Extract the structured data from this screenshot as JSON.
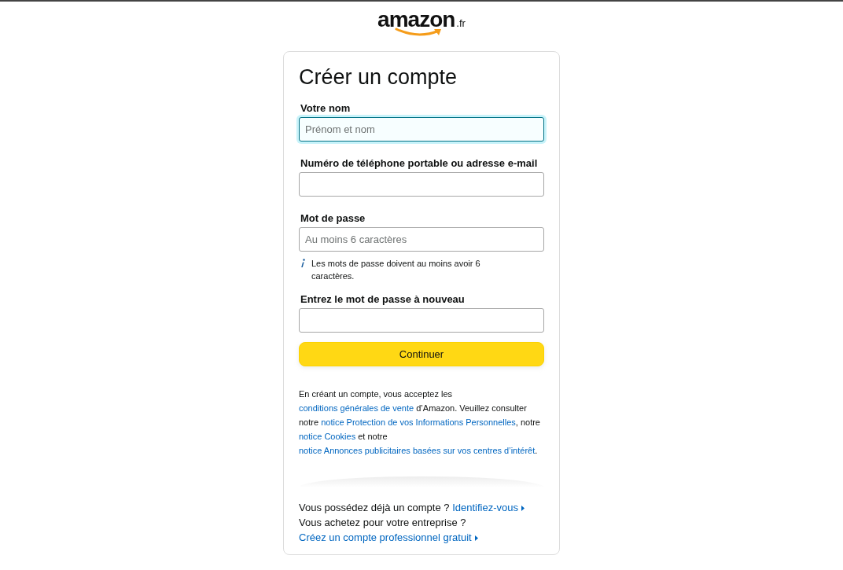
{
  "logo": {
    "wordmark": "amazon",
    "suffix": ".fr"
  },
  "card": {
    "title": "Créer un compte",
    "fields": [
      {
        "label": "Votre nom",
        "placeholder": "Prénom et nom",
        "focused": true
      },
      {
        "label": "Numéro de téléphone portable ou adresse e-mail",
        "focused": false
      },
      {
        "label": "Mot de passe",
        "placeholder": "Au moins 6 caractères",
        "focused": false,
        "hint": "Les mots de passe doivent au moins avoir 6 caractères."
      },
      {
        "label": "Entrez le mot de passe à nouveau",
        "focused": false
      }
    ],
    "submit": "Continuer",
    "legal": [
      {
        "kind": "text",
        "text": "En créant un compte, vous acceptez les "
      },
      {
        "kind": "link",
        "text": "conditions générales de vente"
      },
      {
        "kind": "text",
        "text": " d’Amazon. Veuillez consulter notre "
      },
      {
        "kind": "link",
        "text": "notice Protection de vos Informations Personnelles"
      },
      {
        "kind": "text",
        "text": ", notre "
      },
      {
        "kind": "link",
        "text": "notice Cookies"
      },
      {
        "kind": "text",
        "text": " et notre "
      },
      {
        "kind": "link",
        "text": "notice Annonces publicitaires basées sur vos centres d’intérêt"
      },
      {
        "kind": "text",
        "text": "."
      }
    ],
    "footer": [
      {
        "question": "Vous possédez déjà un compte ?",
        "link": "Identifiez-vous"
      },
      {
        "question": "Vous achetez pour votre entreprise ?",
        "link": "Créez un compte professionnel gratuit"
      }
    ]
  }
}
